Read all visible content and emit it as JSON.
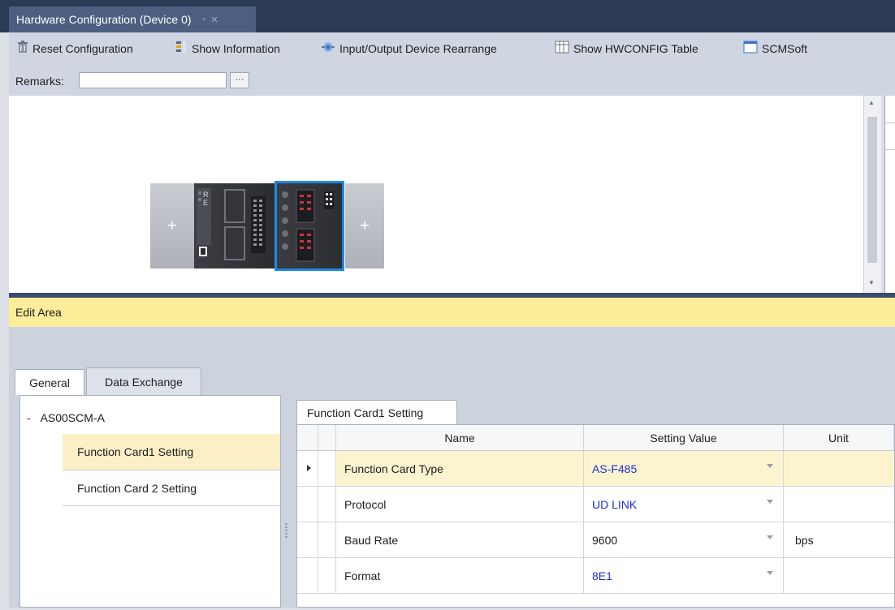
{
  "window": {
    "tab_title": "Hardware Configuration (Device 0)",
    "tab_pin_glyph": "▫",
    "tab_close_glyph": "✕"
  },
  "toolbar": {
    "items": [
      {
        "label": "Reset Configuration",
        "icon": "trash-icon"
      },
      {
        "label": "Show Information",
        "icon": "info-icon"
      },
      {
        "label": "Input/Output Device Rearrange",
        "icon": "rearrange-icon"
      },
      {
        "label": "Show HWCONFIG Table",
        "icon": "table-icon"
      },
      {
        "label": "SCMSoft",
        "icon": "window-icon"
      }
    ]
  },
  "remarks": {
    "label": "Remarks:",
    "value": "",
    "button_label": "···"
  },
  "canvas": {
    "modules": [
      {
        "name": "add-slot-left",
        "glyph": "+"
      },
      {
        "name": "cpu-module",
        "labels": [
          "R",
          "E"
        ]
      },
      {
        "name": "as00scm-a-module",
        "selected": true
      },
      {
        "name": "add-slot-right",
        "glyph": "+"
      }
    ]
  },
  "edit_area": {
    "title": "Edit Area",
    "tabs": [
      {
        "label": "General",
        "active": true
      },
      {
        "label": "Data Exchange",
        "active": false
      }
    ],
    "tree": {
      "root_toggle": "-",
      "root": "AS00SCM-A",
      "items": [
        {
          "label": "Function Card1 Setting",
          "selected": true
        },
        {
          "label": "Function Card 2 Setting",
          "selected": false
        }
      ]
    },
    "settings_tab": "Function Card1 Setting",
    "grid": {
      "columns": [
        "Name",
        "Setting Value",
        "Unit"
      ],
      "rows": [
        {
          "name": "Function Card Type",
          "value": "AS-F485",
          "unit": "",
          "selected": true
        },
        {
          "name": "Protocol",
          "value": "UD LINK",
          "unit": "",
          "selected": false
        },
        {
          "name": "Baud Rate",
          "value": "9600",
          "unit": "bps",
          "selected": false
        },
        {
          "name": "Format",
          "value": "8E1",
          "unit": "",
          "selected": false
        }
      ]
    }
  },
  "colors": {
    "title_bar": "#2b3a55",
    "toolbar_bg": "#cfd6e2",
    "edit_header": "#fbed9a",
    "selection_highlight": "#fcefc6",
    "value_text": "#1f2fd1",
    "module_selection": "#1e88e5"
  }
}
